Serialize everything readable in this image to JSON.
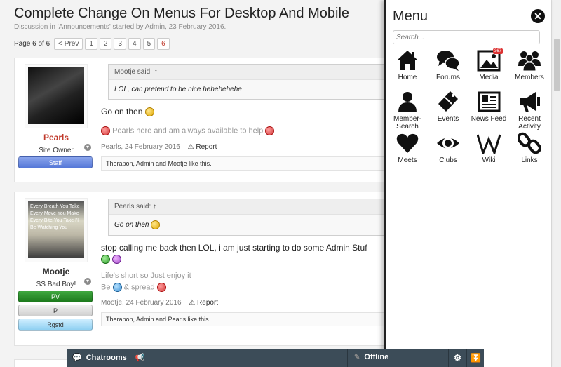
{
  "thread": {
    "title": "Complete Change On Menus For Desktop And Mobile",
    "meta": "Discussion in 'Announcements' started by Admin, 23 February 2016.",
    "pager_label": "Page 6 of 6",
    "pager_prev": "< Prev",
    "pages": [
      "1",
      "2",
      "3",
      "4",
      "5",
      "6"
    ]
  },
  "posts": [
    {
      "username": "Pearls",
      "usertitle": "Site Owner",
      "badges": [
        "Staff"
      ],
      "quote_author": "Mootje said: ↑",
      "quote_text": "LOL, can pretend to be nice hehehehehe",
      "message": "Go on then",
      "signature": "Pearls here and am always available to help",
      "meta_author_date": "Pearls, 24 February 2016",
      "report": "Report",
      "likes": "Therapon, Admin and Mootje like this."
    },
    {
      "username": "Mootje",
      "usertitle": "SS Bad Boy!",
      "badges": [
        "PV",
        "P",
        "Rgstd"
      ],
      "avatar_text": "Every Breath You Take Every Move You Make Every Bite You Take I'll Be Watching You",
      "quote_author": "Pearls said: ↑",
      "quote_text": "Go on then",
      "message": "stop calling me back then LOL, i am just starting to do some Admin Stuf",
      "signature_line1": "Life's short so Just enjoy it",
      "signature_line2_a": "Be",
      "signature_line2_b": "& spread",
      "meta_author_date": "Mootje, 24 February 2016",
      "report": "Report",
      "likes": "Therapon, Admin and Pearls like this."
    }
  ],
  "menu": {
    "title": "Menu",
    "close": "✕",
    "search_placeholder": "Search...",
    "items": [
      {
        "label": "Home",
        "icon": "home-icon"
      },
      {
        "label": "Forums",
        "icon": "forums-icon"
      },
      {
        "label": "Media",
        "icon": "media-icon",
        "badge": "367"
      },
      {
        "label": "Members",
        "icon": "members-icon"
      },
      {
        "label": "Member-Search",
        "icon": "member-search-icon"
      },
      {
        "label": "Events",
        "icon": "events-icon"
      },
      {
        "label": "News Feed",
        "icon": "news-feed-icon"
      },
      {
        "label": "Recent Activity",
        "icon": "recent-activity-icon"
      },
      {
        "label": "Meets",
        "icon": "meets-icon"
      },
      {
        "label": "Clubs",
        "icon": "clubs-icon"
      },
      {
        "label": "Wiki",
        "icon": "wiki-icon"
      },
      {
        "label": "Links",
        "icon": "links-icon"
      }
    ]
  },
  "chat": {
    "rooms_label": "Chatrooms",
    "status": "Offline"
  }
}
